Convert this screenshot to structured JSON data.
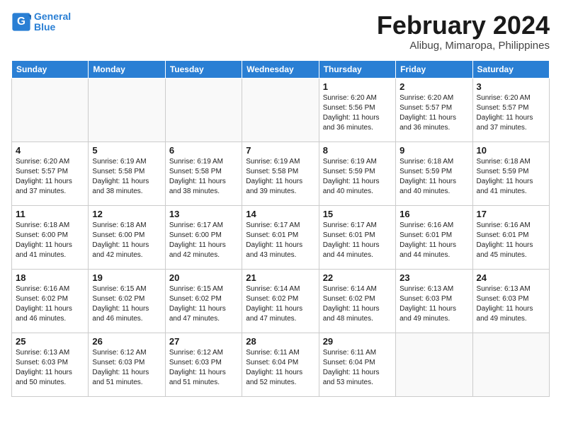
{
  "header": {
    "logo_line1": "General",
    "logo_line2": "Blue",
    "month": "February 2024",
    "location": "Alibug, Mimaropa, Philippines"
  },
  "weekdays": [
    "Sunday",
    "Monday",
    "Tuesday",
    "Wednesday",
    "Thursday",
    "Friday",
    "Saturday"
  ],
  "weeks": [
    [
      {
        "day": "",
        "info": ""
      },
      {
        "day": "",
        "info": ""
      },
      {
        "day": "",
        "info": ""
      },
      {
        "day": "",
        "info": ""
      },
      {
        "day": "1",
        "info": "Sunrise: 6:20 AM\nSunset: 5:56 PM\nDaylight: 11 hours\nand 36 minutes."
      },
      {
        "day": "2",
        "info": "Sunrise: 6:20 AM\nSunset: 5:57 PM\nDaylight: 11 hours\nand 36 minutes."
      },
      {
        "day": "3",
        "info": "Sunrise: 6:20 AM\nSunset: 5:57 PM\nDaylight: 11 hours\nand 37 minutes."
      }
    ],
    [
      {
        "day": "4",
        "info": "Sunrise: 6:20 AM\nSunset: 5:57 PM\nDaylight: 11 hours\nand 37 minutes."
      },
      {
        "day": "5",
        "info": "Sunrise: 6:19 AM\nSunset: 5:58 PM\nDaylight: 11 hours\nand 38 minutes."
      },
      {
        "day": "6",
        "info": "Sunrise: 6:19 AM\nSunset: 5:58 PM\nDaylight: 11 hours\nand 38 minutes."
      },
      {
        "day": "7",
        "info": "Sunrise: 6:19 AM\nSunset: 5:58 PM\nDaylight: 11 hours\nand 39 minutes."
      },
      {
        "day": "8",
        "info": "Sunrise: 6:19 AM\nSunset: 5:59 PM\nDaylight: 11 hours\nand 40 minutes."
      },
      {
        "day": "9",
        "info": "Sunrise: 6:18 AM\nSunset: 5:59 PM\nDaylight: 11 hours\nand 40 minutes."
      },
      {
        "day": "10",
        "info": "Sunrise: 6:18 AM\nSunset: 5:59 PM\nDaylight: 11 hours\nand 41 minutes."
      }
    ],
    [
      {
        "day": "11",
        "info": "Sunrise: 6:18 AM\nSunset: 6:00 PM\nDaylight: 11 hours\nand 41 minutes."
      },
      {
        "day": "12",
        "info": "Sunrise: 6:18 AM\nSunset: 6:00 PM\nDaylight: 11 hours\nand 42 minutes."
      },
      {
        "day": "13",
        "info": "Sunrise: 6:17 AM\nSunset: 6:00 PM\nDaylight: 11 hours\nand 42 minutes."
      },
      {
        "day": "14",
        "info": "Sunrise: 6:17 AM\nSunset: 6:01 PM\nDaylight: 11 hours\nand 43 minutes."
      },
      {
        "day": "15",
        "info": "Sunrise: 6:17 AM\nSunset: 6:01 PM\nDaylight: 11 hours\nand 44 minutes."
      },
      {
        "day": "16",
        "info": "Sunrise: 6:16 AM\nSunset: 6:01 PM\nDaylight: 11 hours\nand 44 minutes."
      },
      {
        "day": "17",
        "info": "Sunrise: 6:16 AM\nSunset: 6:01 PM\nDaylight: 11 hours\nand 45 minutes."
      }
    ],
    [
      {
        "day": "18",
        "info": "Sunrise: 6:16 AM\nSunset: 6:02 PM\nDaylight: 11 hours\nand 46 minutes."
      },
      {
        "day": "19",
        "info": "Sunrise: 6:15 AM\nSunset: 6:02 PM\nDaylight: 11 hours\nand 46 minutes."
      },
      {
        "day": "20",
        "info": "Sunrise: 6:15 AM\nSunset: 6:02 PM\nDaylight: 11 hours\nand 47 minutes."
      },
      {
        "day": "21",
        "info": "Sunrise: 6:14 AM\nSunset: 6:02 PM\nDaylight: 11 hours\nand 47 minutes."
      },
      {
        "day": "22",
        "info": "Sunrise: 6:14 AM\nSunset: 6:02 PM\nDaylight: 11 hours\nand 48 minutes."
      },
      {
        "day": "23",
        "info": "Sunrise: 6:13 AM\nSunset: 6:03 PM\nDaylight: 11 hours\nand 49 minutes."
      },
      {
        "day": "24",
        "info": "Sunrise: 6:13 AM\nSunset: 6:03 PM\nDaylight: 11 hours\nand 49 minutes."
      }
    ],
    [
      {
        "day": "25",
        "info": "Sunrise: 6:13 AM\nSunset: 6:03 PM\nDaylight: 11 hours\nand 50 minutes."
      },
      {
        "day": "26",
        "info": "Sunrise: 6:12 AM\nSunset: 6:03 PM\nDaylight: 11 hours\nand 51 minutes."
      },
      {
        "day": "27",
        "info": "Sunrise: 6:12 AM\nSunset: 6:03 PM\nDaylight: 11 hours\nand 51 minutes."
      },
      {
        "day": "28",
        "info": "Sunrise: 6:11 AM\nSunset: 6:04 PM\nDaylight: 11 hours\nand 52 minutes."
      },
      {
        "day": "29",
        "info": "Sunrise: 6:11 AM\nSunset: 6:04 PM\nDaylight: 11 hours\nand 53 minutes."
      },
      {
        "day": "",
        "info": ""
      },
      {
        "day": "",
        "info": ""
      }
    ]
  ]
}
